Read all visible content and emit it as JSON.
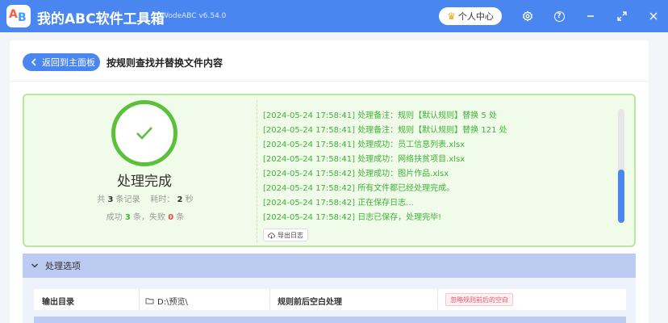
{
  "app": {
    "logo_letters": [
      "A",
      "B"
    ],
    "title": "我的ABC软件工具箱",
    "version": "WodeABC v6.54.0",
    "user_center": "个人中心"
  },
  "nav": {
    "back_label": "返回到主面板",
    "page_title": "按规则查找并替换文件内容"
  },
  "result": {
    "status_title": "处理完成",
    "total_prefix": "共",
    "total_count": "3",
    "total_suffix": "条记录",
    "time_label": "耗时：",
    "time_value": "2",
    "time_unit": "秒",
    "success_label": "成功",
    "success_count": "3",
    "success_unit": "条，失败",
    "fail_count": "0",
    "fail_unit": "条",
    "export_label": "导出日志"
  },
  "log_lines": [
    "[2024-05-24 17:58:41] 处理备注：规则【默认规则】替换 5 处",
    "[2024-05-24 17:58:41] 处理备注：规则【默认规则】替换 121 处",
    "[2024-05-24 17:58:41] 处理成功：员工信息列表.xlsx",
    "[2024-05-24 17:58:41] 处理成功：网络扶贫项目.xlsx",
    "[2024-05-24 17:58:42] 处理成功：图片作品.xlsx",
    "[2024-05-24 17:58:42] 所有文件都已经处理完成。",
    "[2024-05-24 17:58:42] 正在保存日志...",
    "[2024-05-24 17:58:42] 日志已保存，处理完毕!"
  ],
  "options": {
    "section_title": "处理选项",
    "output_dir_label": "输出目录",
    "output_dir_value": "D:\\预览\\",
    "whitespace_label": "规则前后空白处理",
    "whitespace_value": "忽略规则前后的空白"
  },
  "colors": {
    "accent": "#4a86f0",
    "success": "#3eb337",
    "fail": "#ee4a3a"
  }
}
